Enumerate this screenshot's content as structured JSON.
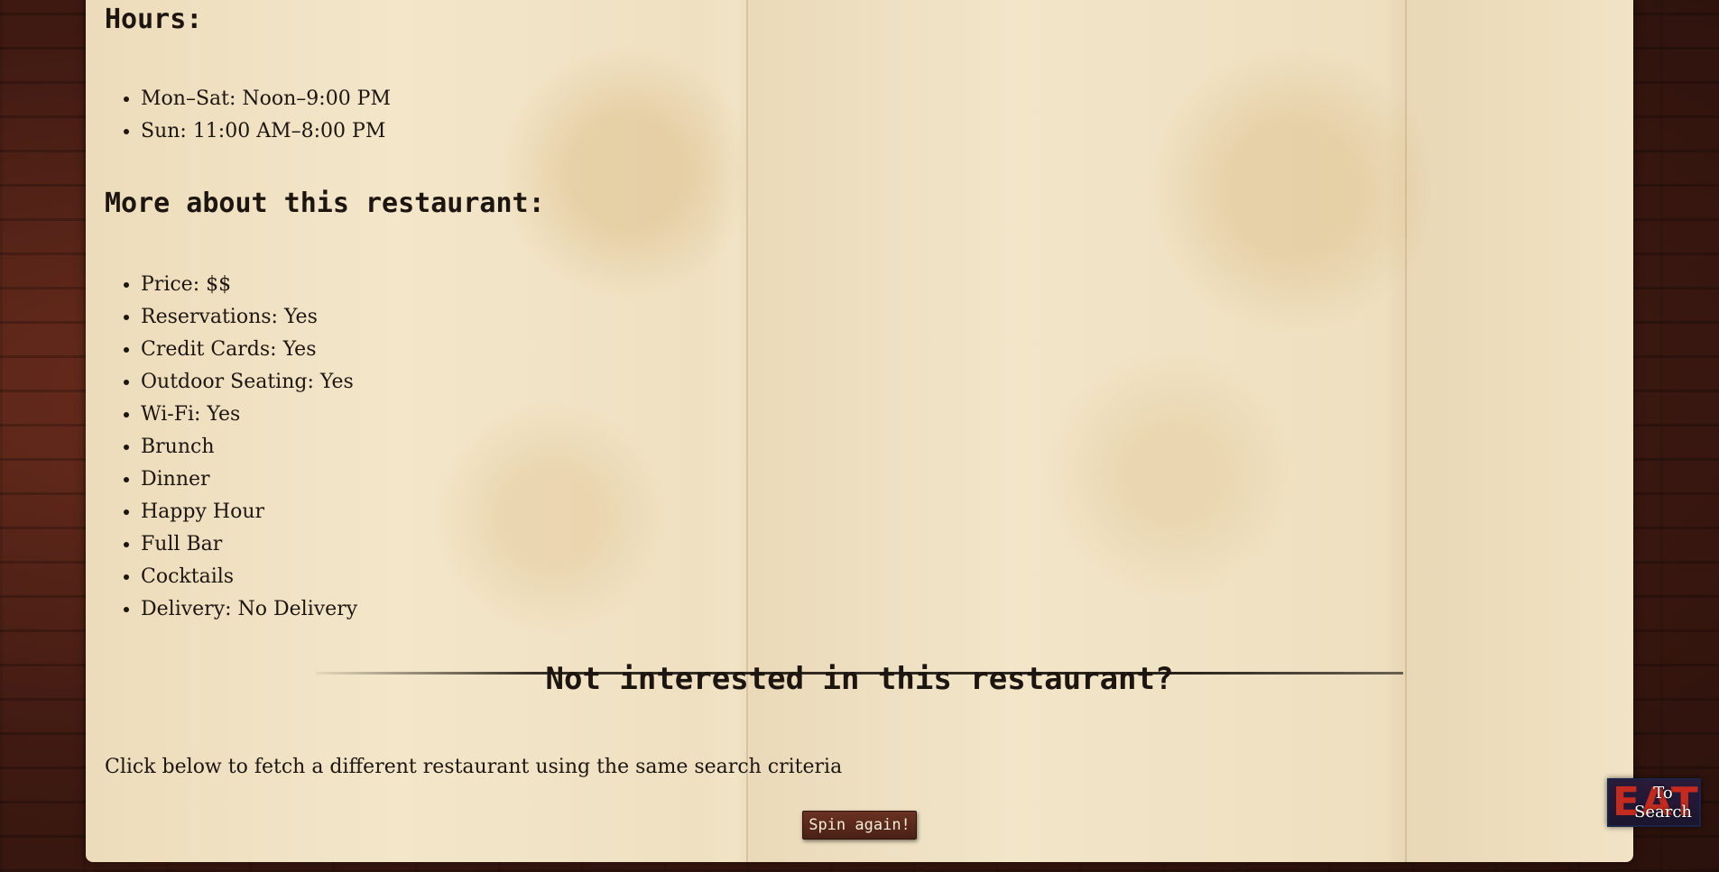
{
  "hours": {
    "heading": "Hours:",
    "items": [
      "Mon–Sat: Noon–9:00 PM",
      "Sun: 11:00 AM–8:00 PM"
    ]
  },
  "details": {
    "heading": "More about this restaurant:",
    "items": [
      "Price: $$",
      "Reservations: Yes",
      "Credit Cards: Yes",
      "Outdoor Seating: Yes",
      "Wi-Fi: Yes",
      "Brunch",
      "Dinner",
      "Happy Hour",
      "Full Bar",
      "Cocktails",
      "Delivery: No Delivery"
    ]
  },
  "respin": {
    "heading": "Not interested in this restaurant?",
    "hint": "Click below to fetch a different restaurant using the same search criteria",
    "button_label": "Spin again!"
  },
  "to_search": {
    "logo_text": "EAT",
    "label_line1": "To",
    "label_line2": "Search"
  }
}
